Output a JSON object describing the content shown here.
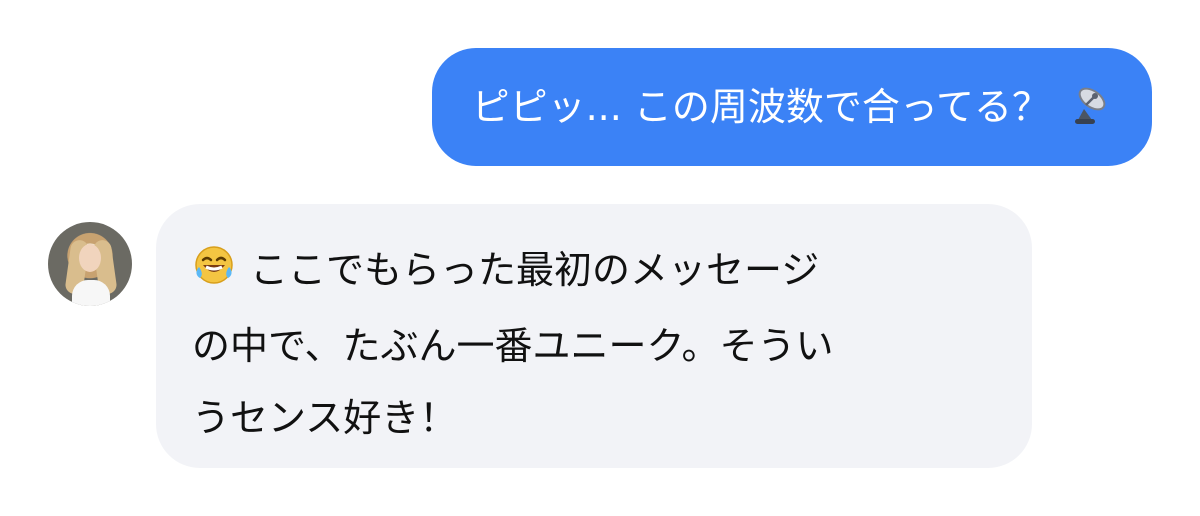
{
  "messages": {
    "outgoing": {
      "text": "ピピッ... この周波数で合ってる？",
      "emoji_icon": "satellite-dish-icon",
      "bubble_color": "#3b82f6"
    },
    "incoming": {
      "emoji_icon": "laughing-tears-icon",
      "lines": [
        "ここでもらった最初のメッセージ",
        "の中で、たぶん一番ユニーク。そうい",
        "うセンス好き！"
      ],
      "bubble_color": "#f2f3f7"
    }
  }
}
